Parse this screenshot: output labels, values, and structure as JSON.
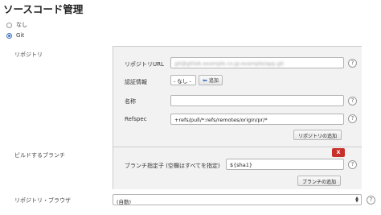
{
  "section_title": "ソースコード管理",
  "scm_options": [
    {
      "label": "なし",
      "checked": false
    },
    {
      "label": "Git",
      "checked": true
    }
  ],
  "repositories": {
    "label": "リポジトリ",
    "url_label": "リポジトリURL",
    "url_value": "git@gitlab.example.co.jp:example/app.git",
    "credentials_label": "認証情報",
    "credentials_value": "- なし -",
    "add_button": "追加",
    "name_label": "名称",
    "name_value": "",
    "refspec_label": "Refspec",
    "refspec_value": "+refs/pull/*:refs/remotes/origin/pr/*",
    "add_repository_button": "リポジトリの追加"
  },
  "branches": {
    "label": "ビルドするブランチ",
    "delete_button": "X",
    "branch_spec_label": "ブランチ指定子 (空欄はすべてを指定)",
    "branch_spec_value": "${sha1}",
    "add_branch_button": "ブランチの追加"
  },
  "browser": {
    "label": "リポジトリ・ブラウザ",
    "value": "(自動)"
  },
  "help_glyph": "?"
}
